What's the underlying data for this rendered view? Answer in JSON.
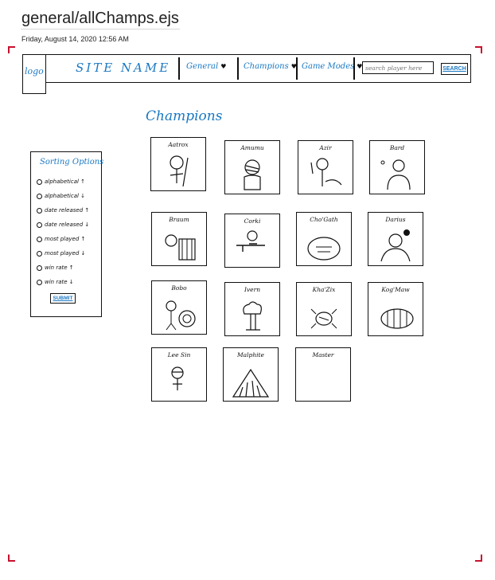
{
  "document": {
    "title": "general/allChamps.ejs",
    "date": "Friday, August 14, 2020     12:56 AM"
  },
  "nav": {
    "logo": "logo",
    "site_name": "SITE NAME",
    "items": [
      {
        "label": "General",
        "icon": "chevron-down-icon"
      },
      {
        "label": "Champions",
        "icon": "chevron-down-icon"
      },
      {
        "label": "Game Modes",
        "icon": "chevron-down-icon"
      }
    ],
    "search_placeholder": "search player here",
    "search_button": "SEARCH"
  },
  "sorting": {
    "title": "Sorting Options",
    "options": [
      "alphabetical ↑",
      "alphabetical ↓",
      "date released ↑",
      "date released ↓",
      "most played ↑",
      "most played ↓",
      "win rate ↑",
      "win rate ↓"
    ],
    "submit": "SUBMIT"
  },
  "champions": {
    "heading": "Champions",
    "cards": [
      {
        "name": "Aatrox"
      },
      {
        "name": "Amumu"
      },
      {
        "name": "Azir"
      },
      {
        "name": "Bard"
      },
      {
        "name": "Braum"
      },
      {
        "name": "Corki"
      },
      {
        "name": "Cho'Gath"
      },
      {
        "name": "Darius"
      },
      {
        "name": "Bobo"
      },
      {
        "name": "Ivern"
      },
      {
        "name": "Kha'Zix"
      },
      {
        "name": "Kog'Maw"
      },
      {
        "name": "Lee Sin"
      },
      {
        "name": "Malphite"
      },
      {
        "name": "Master"
      }
    ]
  },
  "colors": {
    "accent_blue": "#1a78c2",
    "frame_red": "#c8102e",
    "ink": "#111111"
  }
}
